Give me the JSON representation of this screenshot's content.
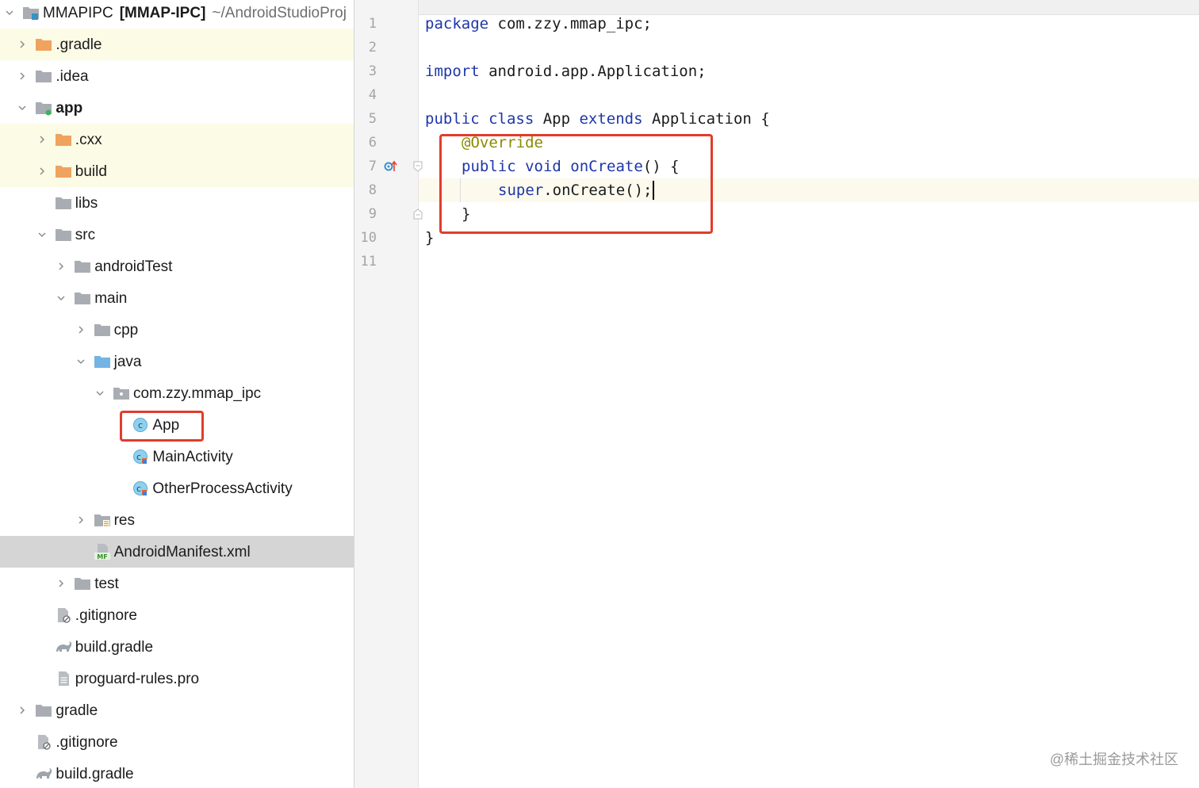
{
  "project": {
    "name": "MMAPIPC",
    "module": "[MMAP-IPC]",
    "path": "~/AndroidStudioProj"
  },
  "tree": [
    {
      "label": ".gradle",
      "icon": "folder-orange",
      "chevron": "right"
    },
    {
      "label": ".idea",
      "icon": "folder-gray",
      "chevron": "right"
    },
    {
      "label": "app",
      "icon": "module-folder",
      "chevron": "down"
    },
    {
      "label": ".cxx",
      "icon": "folder-orange",
      "chevron": "right"
    },
    {
      "label": "build",
      "icon": "folder-orange",
      "chevron": "right"
    },
    {
      "label": "libs",
      "icon": "folder-gray",
      "chevron": "none"
    },
    {
      "label": "src",
      "icon": "folder-gray",
      "chevron": "down"
    },
    {
      "label": "androidTest",
      "icon": "folder-gray",
      "chevron": "right"
    },
    {
      "label": "main",
      "icon": "folder-gray",
      "chevron": "down"
    },
    {
      "label": "cpp",
      "icon": "folder-gray",
      "chevron": "right"
    },
    {
      "label": "java",
      "icon": "folder-blue",
      "chevron": "down"
    },
    {
      "label": "com.zzy.mmap_ipc",
      "icon": "package-folder",
      "chevron": "down"
    },
    {
      "label": "App",
      "icon": "class-icon",
      "chevron": "none"
    },
    {
      "label": "MainActivity",
      "icon": "activity-class-icon",
      "chevron": "none"
    },
    {
      "label": "OtherProcessActivity",
      "icon": "activity-class-icon",
      "chevron": "none"
    },
    {
      "label": "res",
      "icon": "res-folder",
      "chevron": "right"
    },
    {
      "label": "AndroidManifest.xml",
      "icon": "manifest-file-icon",
      "chevron": "none"
    },
    {
      "label": "test",
      "icon": "folder-gray",
      "chevron": "right"
    },
    {
      "label": ".gitignore",
      "icon": "gitignore-file-icon",
      "chevron": "none"
    },
    {
      "label": "build.gradle",
      "icon": "gradle-file-icon",
      "chevron": "none"
    },
    {
      "label": "proguard-rules.pro",
      "icon": "text-file-icon",
      "chevron": "none"
    },
    {
      "label": "gradle",
      "icon": "folder-gray",
      "chevron": "right"
    },
    {
      "label": ".gitignore",
      "icon": "gitignore-file-icon",
      "chevron": "none"
    },
    {
      "label": "build.gradle",
      "icon": "gradle-file-icon",
      "chevron": "none"
    }
  ],
  "editor": {
    "line_numbers": [
      "1",
      "2",
      "3",
      "4",
      "5",
      "6",
      "7",
      "8",
      "9",
      "10",
      "11"
    ],
    "line1": {
      "kw": "package",
      "rest": " com.zzy.mmap_ipc;"
    },
    "line3": {
      "kw": "import",
      "rest": " android.app.Application;"
    },
    "line5": {
      "kw1": "public class",
      "name": " App ",
      "kw2": "extends",
      "rest": " Application {"
    },
    "line6": {
      "ann": "@Override"
    },
    "line7": {
      "kw": "public void",
      "meth": " onCreate",
      "rest": "() {"
    },
    "line8": {
      "kw": "super",
      "rest": ".onCreate();"
    },
    "line9": {
      "rest": "}"
    },
    "line10": {
      "rest": "}"
    }
  },
  "colors": {
    "keyword": "#1e36a8",
    "annotation": "#8b8b00",
    "highlight_box": "#e23c2b"
  },
  "watermark": "@稀土掘金技术社区"
}
